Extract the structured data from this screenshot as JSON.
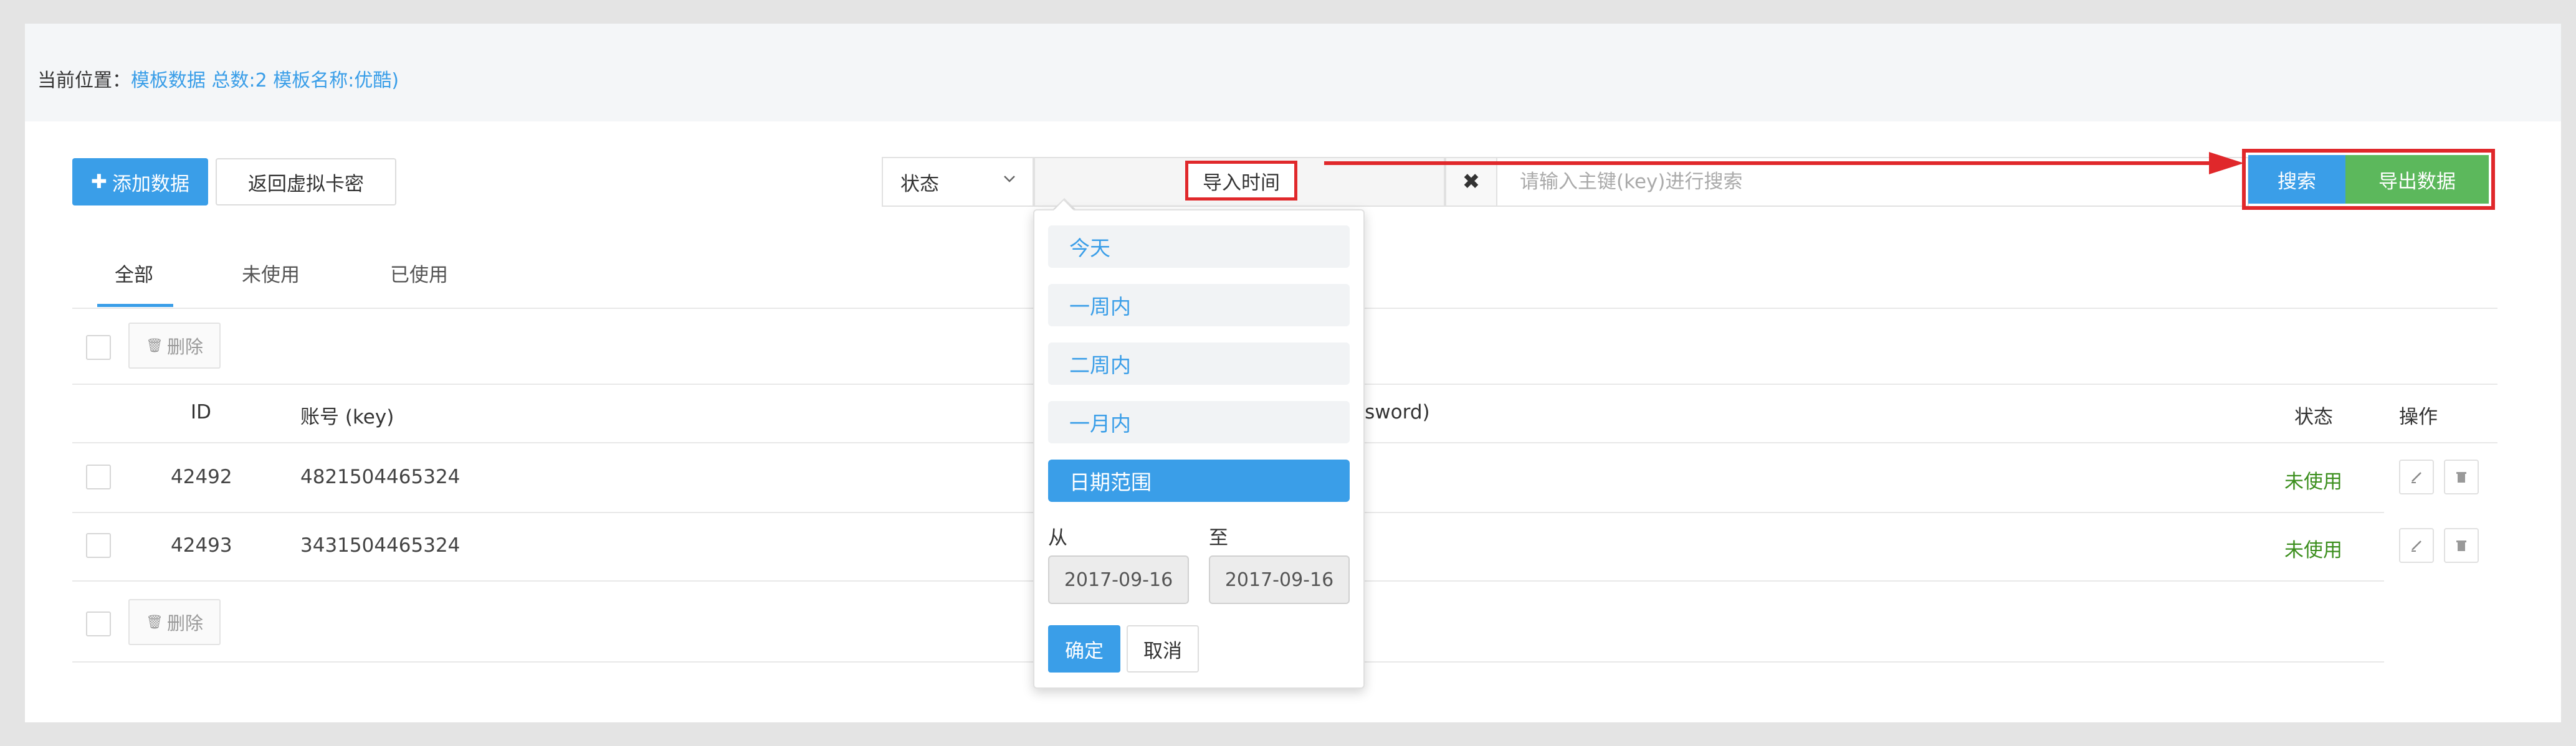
{
  "breadcrumb": {
    "prefix": "当前位置：",
    "section": "模板数据",
    "total": "总数:2",
    "template": "模板名称:优酷)"
  },
  "toolbar": {
    "add_icon": "✚",
    "add_label": "添加数据",
    "back_label": "返回虚拟卡密",
    "status_label": "状态",
    "import_time_label": "导入时间",
    "clear_icon": "✖",
    "search_placeholder": "请输入主键(key)进行搜索",
    "search_label": "搜索",
    "export_label": "导出数据"
  },
  "tabs": [
    "全部",
    "未使用",
    "已使用"
  ],
  "bulk": {
    "delete_label": "删除",
    "trash_icon": "🗑"
  },
  "table": {
    "headers": {
      "id": "ID",
      "key": "账号 (key)",
      "password": "ssword)",
      "status": "状态",
      "ops": "操作"
    },
    "rows": [
      {
        "id": "42492",
        "key": "4821504465324",
        "status": "未使用"
      },
      {
        "id": "42493",
        "key": "3431504465324",
        "status": "未使用"
      }
    ]
  },
  "date_dropdown": {
    "ranges": [
      "今天",
      "一周内",
      "二周内",
      "一月内",
      "日期范围"
    ],
    "selected": "日期范围",
    "from_label": "从",
    "to_label": "至",
    "from_value": "2017-09-16",
    "to_value": "2017-09-16",
    "confirm_label": "确定",
    "cancel_label": "取消"
  },
  "colors": {
    "primary": "#3a9ee8",
    "export_green": "#5cb85c",
    "highlight_red": "#e0282b",
    "status_green": "#3c8f1e"
  }
}
